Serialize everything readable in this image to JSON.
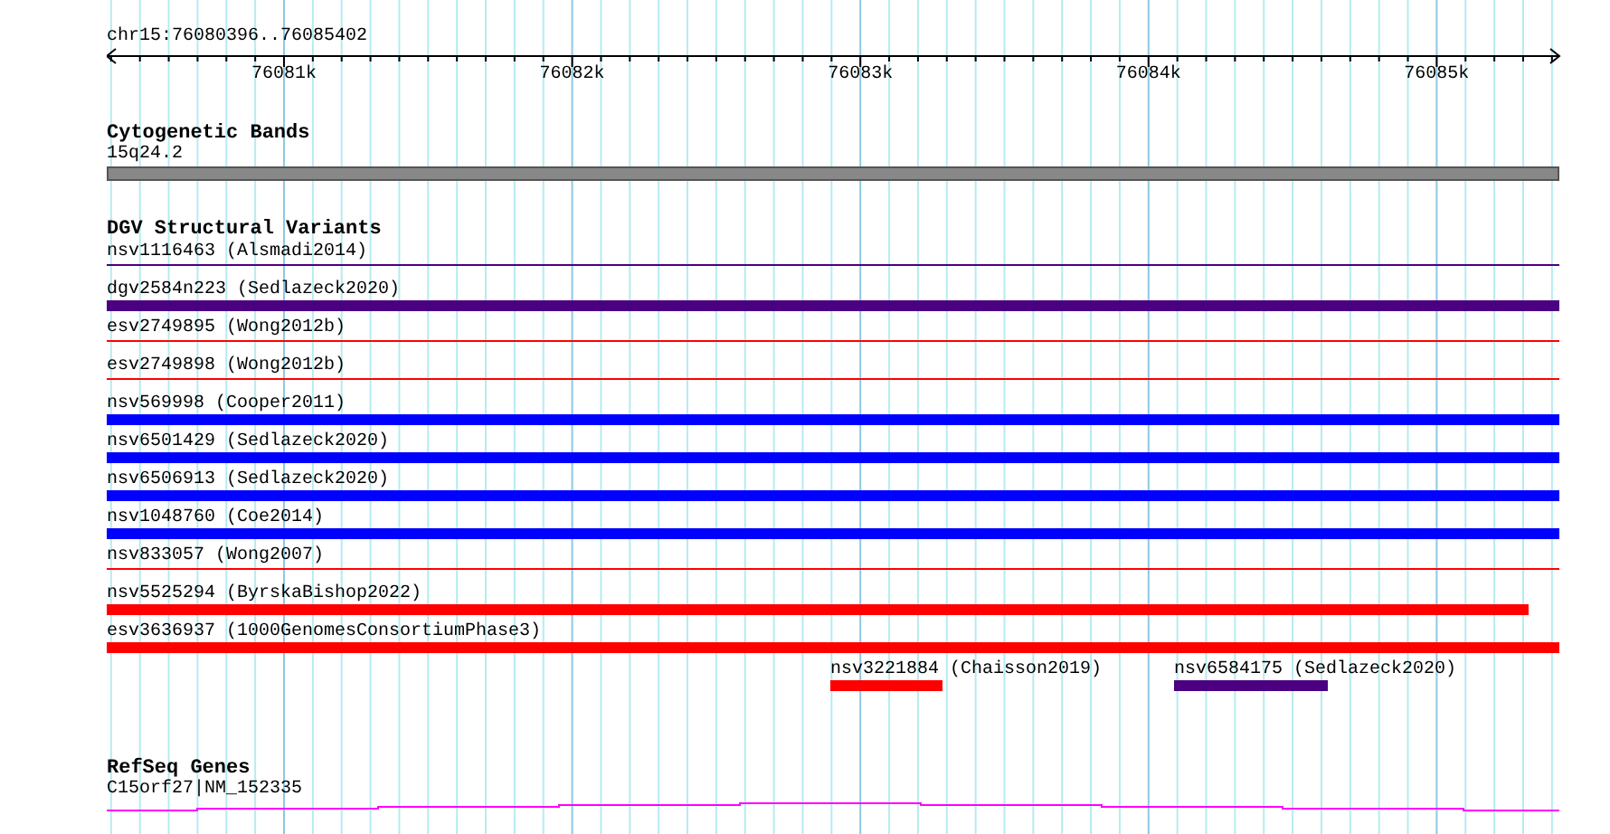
{
  "ruler": {
    "region": "chr15:76080396..76085402",
    "ticks": [
      "76081k",
      "76082k",
      "76083k",
      "76084k",
      "76085k"
    ]
  },
  "cytogenetic_bands": {
    "title": "Cytogenetic Bands",
    "band": "15q24.2"
  },
  "dgv_structural_variants": {
    "title": "DGV Structural Variants",
    "rows": [
      {
        "label": "nsv1116463 (Alsmadi2014)",
        "kind": "line",
        "color": "#4b0082"
      },
      {
        "label": "dgv2584n223 (Sedlazeck2020)",
        "kind": "bar",
        "color": "#4b0082"
      },
      {
        "label": "esv2749895 (Wong2012b)",
        "kind": "line",
        "color": "#ff0000"
      },
      {
        "label": "esv2749898 (Wong2012b)",
        "kind": "line",
        "color": "#ff0000"
      },
      {
        "label": "nsv569998 (Cooper2011)",
        "kind": "bar",
        "color": "#0000ff"
      },
      {
        "label": "nsv6501429 (Sedlazeck2020)",
        "kind": "bar",
        "color": "#0000ff"
      },
      {
        "label": "nsv6506913 (Sedlazeck2020)",
        "kind": "bar",
        "color": "#0000ff"
      },
      {
        "label": "nsv1048760 (Coe2014)",
        "kind": "bar",
        "color": "#0000ff"
      },
      {
        "label": "nsv833057 (Wong2007)",
        "kind": "line",
        "color": "#ff0000"
      },
      {
        "label": "nsv5525294 (ByrskaBishop2022)",
        "kind": "bar",
        "color": "#ff0000"
      },
      {
        "label": "esv3636937 (1000GenomesConsortiumPhase3)",
        "kind": "bar",
        "color": "#ff0000"
      }
    ],
    "partial": [
      {
        "label": "nsv3221884 (Chaisson2019)",
        "kind": "bar",
        "color": "#ff0000"
      },
      {
        "label": "nsv6584175 (Sedlazeck2020)",
        "kind": "bar",
        "color": "#4b0082"
      }
    ]
  },
  "refseq_genes": {
    "title": "RefSeq Genes",
    "gene": "C15orf27|NM_152335"
  }
}
